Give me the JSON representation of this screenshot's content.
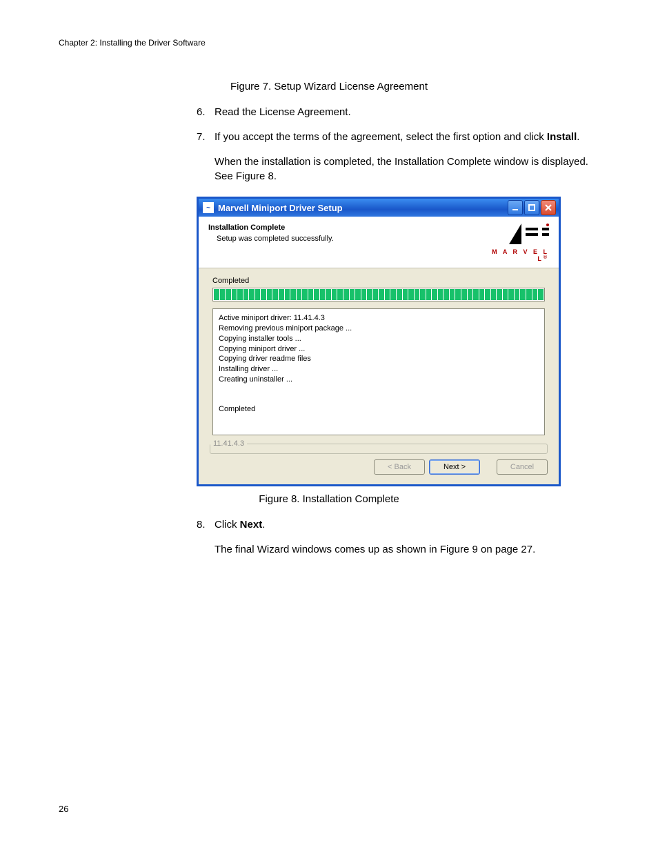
{
  "running_head": "Chapter 2: Installing the Driver Software",
  "fig7_caption": "Figure 7. Setup Wizard License Agreement",
  "step6_num": "6.",
  "step6_txt": "Read the License Agreement.",
  "step7_num": "7.",
  "step7_a": "If you accept the terms of the agreement, select the first option and click ",
  "step7_b": "Install",
  "step7_c": ".",
  "after7": "When the installation is completed, the Installation Complete window is displayed. See Figure 8.",
  "fig8_caption": "Figure 8. Installation Complete",
  "step8_num": "8.",
  "step8_a": "Click ",
  "step8_b": "Next",
  "step8_c": ".",
  "after8": "The final Wizard windows comes up as shown in Figure 9 on page 27.",
  "page_number": "26",
  "dialog": {
    "title": "Marvell Miniport Driver Setup",
    "head_title": "Installation Complete",
    "head_sub": "Setup was completed successfully.",
    "brand": "M A R V E L L",
    "brand_reg": "®",
    "status": "Completed",
    "log": [
      "Active miniport driver: 11.41.4.3",
      "Removing previous miniport package ...",
      "Copying installer tools ...",
      "Copying miniport driver ...",
      "Copying driver readme files",
      "Installing driver ...",
      "Creating uninstaller ..."
    ],
    "log_last": "Completed",
    "version": "11.41.4.3",
    "btn_back": "< Back",
    "btn_next": "Next >",
    "btn_cancel": "Cancel"
  }
}
